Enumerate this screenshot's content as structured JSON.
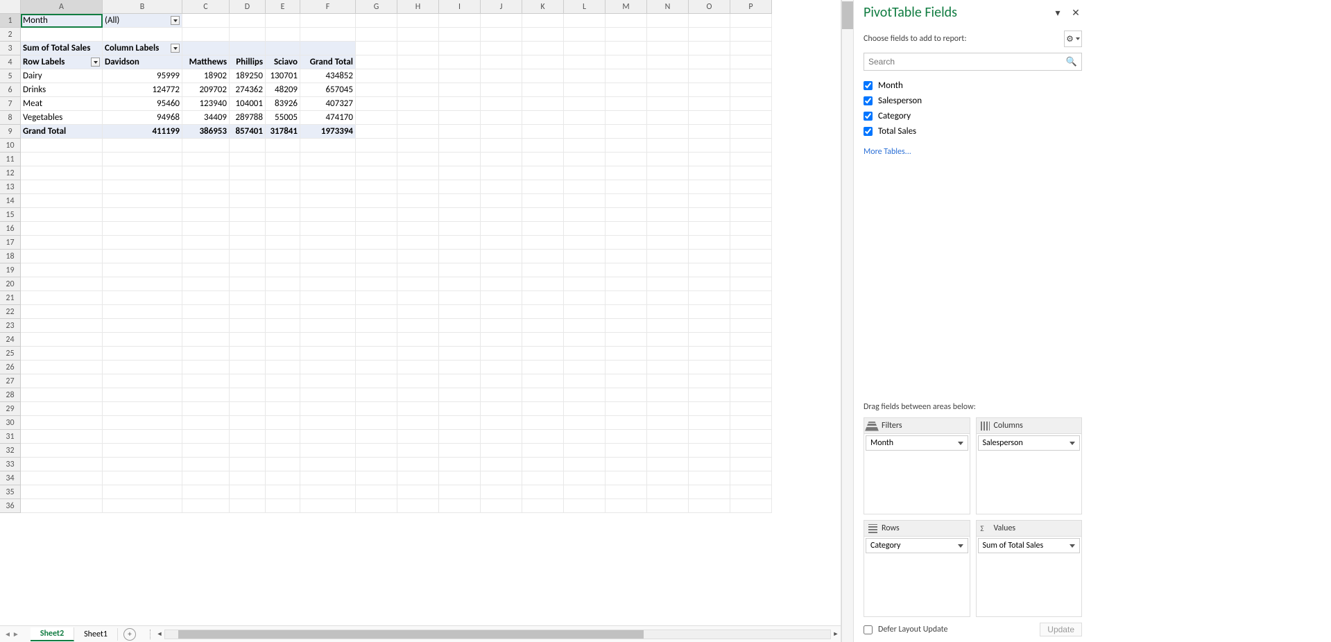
{
  "cols": [
    "A",
    "B",
    "C",
    "D",
    "E",
    "F",
    "G",
    "H",
    "I",
    "J",
    "K",
    "L",
    "M",
    "N",
    "O",
    "P"
  ],
  "rows": 36,
  "filter_row": {
    "label": "Month",
    "value": "(All)"
  },
  "pivot": {
    "measure": "Sum of Total Sales",
    "col_label": "Column Labels",
    "row_label": "Row Labels",
    "col_headers": [
      "Davidson",
      "Matthews",
      "Phillips",
      "Sciavo",
      "Grand Total"
    ],
    "rows": [
      {
        "label": "Dairy",
        "vals": [
          "95999",
          "18902",
          "189250",
          "130701",
          "434852"
        ]
      },
      {
        "label": "Drinks",
        "vals": [
          "124772",
          "209702",
          "274362",
          "48209",
          "657045"
        ]
      },
      {
        "label": "Meat",
        "vals": [
          "95460",
          "123940",
          "104001",
          "83926",
          "407327"
        ]
      },
      {
        "label": "Vegetables",
        "vals": [
          "94968",
          "34409",
          "289788",
          "55005",
          "474170"
        ]
      }
    ],
    "grand_label": "Grand Total",
    "grand_vals": [
      "411199",
      "386953",
      "857401",
      "317841",
      "1973394"
    ]
  },
  "tabs": {
    "active": "Sheet2",
    "other": "Sheet1"
  },
  "pane": {
    "title": "PivotTable Fields",
    "subtitle": "Choose fields to add to report:",
    "search_placeholder": "Search",
    "fields": [
      "Month",
      "Salesperson",
      "Category",
      "Total Sales"
    ],
    "more": "More Tables...",
    "drag_note": "Drag fields between areas below:",
    "areas": {
      "filters": {
        "label": "Filters",
        "item": "Month"
      },
      "columns": {
        "label": "Columns",
        "item": "Salesperson"
      },
      "rows": {
        "label": "Rows",
        "item": "Category"
      },
      "values": {
        "label": "Values",
        "item": "Sum of Total Sales"
      }
    },
    "defer": "Defer Layout Update",
    "update": "Update"
  }
}
